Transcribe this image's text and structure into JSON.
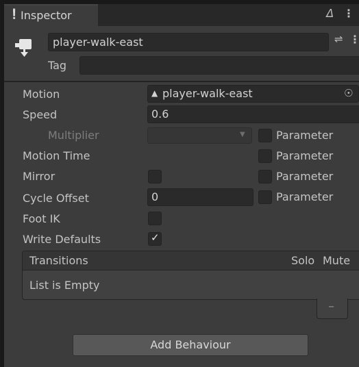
{
  "tab": {
    "title": "Inspector"
  },
  "object": {
    "name": "player-walk-east",
    "tag_label": "Tag",
    "tag_value": ""
  },
  "fields": {
    "motion": {
      "label": "Motion",
      "value": "player-walk-east"
    },
    "speed": {
      "label": "Speed",
      "value": "0.6"
    },
    "multiplier": {
      "label": "Multiplier",
      "value": "",
      "param_label": "Parameter",
      "param_checked": false
    },
    "motion_time": {
      "label": "Motion Time",
      "param_label": "Parameter",
      "param_checked": false
    },
    "mirror": {
      "label": "Mirror",
      "checked": false,
      "param_label": "Parameter",
      "param_checked": false
    },
    "cycle_offset": {
      "label": "Cycle Offset",
      "value": "0",
      "param_label": "Parameter",
      "param_checked": false
    },
    "foot_ik": {
      "label": "Foot IK",
      "checked": false
    },
    "write_defaults": {
      "label": "Write Defaults",
      "checked": true
    }
  },
  "transitions": {
    "header": "Transitions",
    "solo_label": "Solo",
    "mute_label": "Mute",
    "empty_text": "List is Empty",
    "remove_label": "–"
  },
  "add_behaviour_label": "Add Behaviour",
  "icons": {
    "info": "info-icon",
    "lock": "lock-icon",
    "menu": "kebab-menu-icon",
    "game_object": "game-object-icon",
    "presets": "presets-icon",
    "motion_asset": "animation-clip-icon",
    "object_picker": "object-picker-icon",
    "dropdown": "dropdown-arrow-icon",
    "check": "checkmark-icon"
  }
}
